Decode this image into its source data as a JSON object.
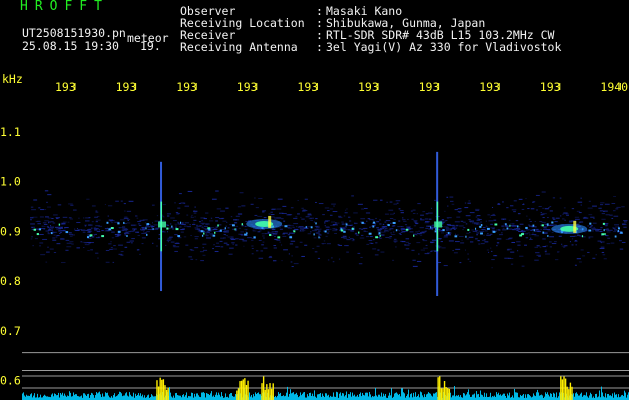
{
  "header": {
    "brand": "HROFFT",
    "filename": "UT2508151930.pn",
    "event_tag": "meteor",
    "datetime": "25.08.15 19:30",
    "seconds": "19.",
    "fields": [
      {
        "label": "Observer",
        "value": "Masaki Kano"
      },
      {
        "label": "Receiving Location",
        "value": "Shibukawa, Gunma, Japan"
      },
      {
        "label": "Receiver",
        "value": "RTL-SDR SDR# 43dB L15 103.2MHz CW"
      },
      {
        "label": "Receiving Antenna",
        "value": "3el Yagi(V) Az 330 for Vladivostok"
      }
    ]
  },
  "spectrogram": {
    "y_unit": "kHz",
    "y_ticks": [
      "1.1",
      "1.0",
      "0.9",
      "0.8",
      "0.7",
      "0.6"
    ],
    "y_values": [
      1.1,
      1.0,
      0.9,
      0.8,
      0.7,
      0.6
    ],
    "x_ticks": [
      "193",
      "193",
      "193",
      "193",
      "193",
      "193",
      "193",
      "193",
      "193",
      "1940"
    ],
    "ylim": [
      0.58,
      1.15
    ],
    "colors": {
      "background": "#000000",
      "noise": "#1a2aa0",
      "signal": "#44ffaa",
      "hot": "#ffff44",
      "baseline": "#00ccff",
      "burst": "#ffee00",
      "grid": "#9a9a9a"
    },
    "meteors": [
      {
        "x_frac": 0.256,
        "freq_top": 1.04,
        "freq_bottom": 0.78,
        "type": "vertical"
      },
      {
        "x_frac": 0.695,
        "freq_top": 1.06,
        "freq_bottom": 0.77,
        "type": "vertical"
      },
      {
        "x_frac": 0.42,
        "freq_center": 0.915,
        "type": "blob"
      },
      {
        "x_frac": 0.905,
        "freq_center": 0.905,
        "type": "blob"
      }
    ],
    "bursts": [
      0.258,
      0.385,
      0.425,
      0.705,
      0.9
    ]
  }
}
